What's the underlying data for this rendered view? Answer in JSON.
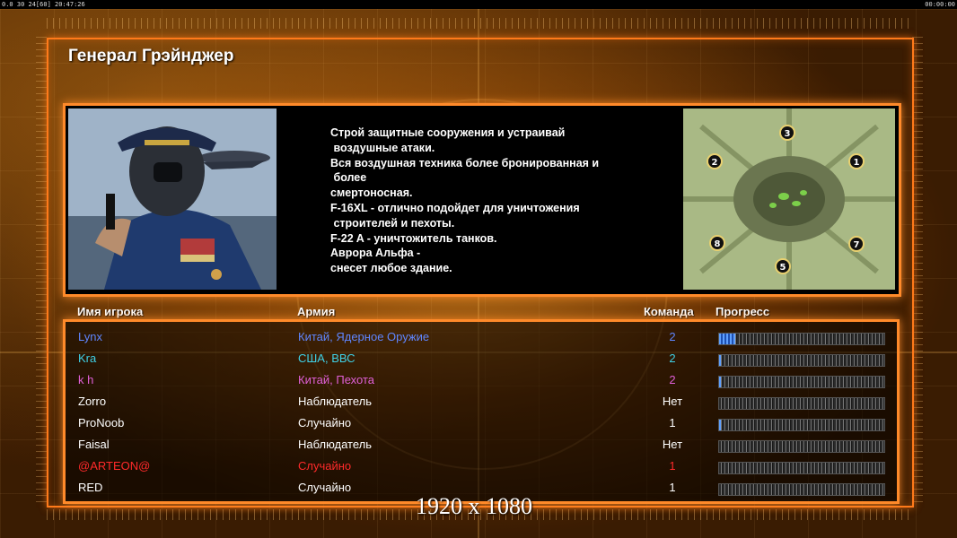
{
  "status_bar": {
    "left": "0.0 30 24[60] 20:47:26",
    "right": "00:00:00"
  },
  "general_name": "Генерал Грэйнджер",
  "description_lines": [
    "Строй защитные сооружения и устраивай",
    " воздушные атаки.",
    "Вся воздушная техника более бронированная и",
    " более",
    "смертоносная.",
    "F-16XL - отлично подойдет для уничтожения",
    " строителей и пехоты.",
    "F-22 A - уничтожитель танков.",
    "Аврора Альфа -",
    "снесет любое здание."
  ],
  "minimap": {
    "start_positions": [
      "3",
      "2",
      "1",
      "8",
      "7",
      "5"
    ]
  },
  "table": {
    "headers": {
      "player": "Имя игрока",
      "army": "Армия",
      "team": "Команда",
      "progress": "Прогресс"
    },
    "rows": [
      {
        "name": "Lynx",
        "army": "Китай, Ядерное Оружие",
        "team": "2",
        "color": "#5f86ff",
        "progress": 0.1
      },
      {
        "name": "Kra",
        "army": "США, ВВС",
        "team": "2",
        "color": "#3fd0e6",
        "progress": 0.01
      },
      {
        "name": "k h",
        "army": "Китай, Пехота",
        "team": "2",
        "color": "#e060d8",
        "progress": 0.01
      },
      {
        "name": "Zorro",
        "army": "Наблюдатель",
        "team": "Нет",
        "color": "#ffffff",
        "progress": 0
      },
      {
        "name": "ProNoob",
        "army": "Случайно",
        "team": "1",
        "color": "#ffffff",
        "progress": 0.01
      },
      {
        "name": "Faisal",
        "army": "Наблюдатель",
        "team": "Нет",
        "color": "#ffffff",
        "progress": 0
      },
      {
        "name": "@ARTEON@",
        "army": "Случайно",
        "team": "1",
        "color": "#ff2a2a",
        "progress": 0
      },
      {
        "name": "RED",
        "army": "Случайно",
        "team": "1",
        "color": "#ffffff",
        "progress": 0
      }
    ]
  },
  "resolution_text": "1920 x 1080",
  "colors": {
    "frame_orange": "#ff8a2a",
    "background": "#2a1200"
  }
}
